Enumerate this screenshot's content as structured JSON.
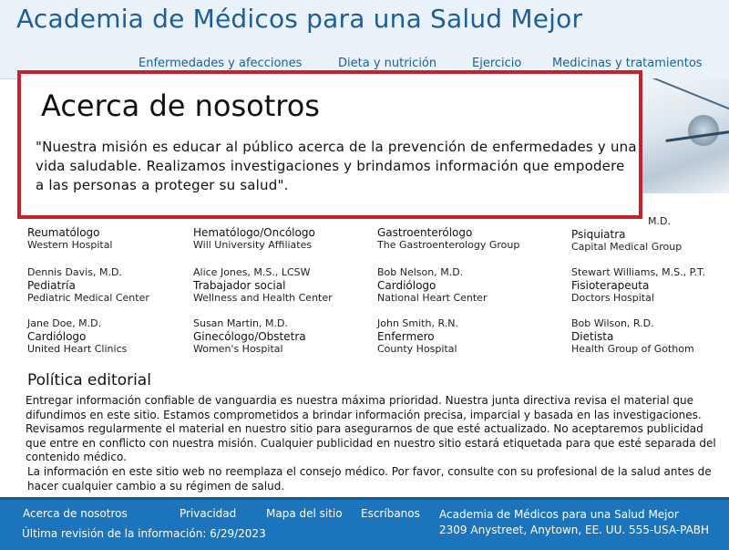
{
  "site_title": "Academia de Médicos para una Salud Mejor",
  "nav": [
    {
      "label": "Enfermedades y afecciones"
    },
    {
      "label": "Dieta y nutrición"
    },
    {
      "label": "Ejercicio"
    },
    {
      "label": "Medicinas y tratamientos"
    }
  ],
  "callout": {
    "title": "Acerca de nosotros",
    "body": "\"Nuestra misión es educar al público acerca de la prevención de enfermedades y una vida saludable. Realizamos investigaciones y brindamos información que empodere a las personas a proteger su salud\"."
  },
  "staff": [
    {
      "name": "",
      "role": "Reumatólogo",
      "org": "Western Hospital"
    },
    {
      "name": "",
      "role": "Hematólogo/Oncólogo",
      "org": "Will University Affiliates"
    },
    {
      "name": "",
      "role": "Gastroenterólogo",
      "org": "The Gastroenterology Group"
    },
    {
      "name": "M.D.",
      "role": "Psiquiatra",
      "org": "Capital Medical Group"
    },
    {
      "name": "Dennis Davis, M.D.",
      "role": "Pediatría",
      "org": "Pediatric Medical Center"
    },
    {
      "name": "Alice Jones, M.S., LCSW",
      "role": "Trabajador social",
      "org": "Wellness and Health Center"
    },
    {
      "name": "Bob Nelson, M.D.",
      "role": "Cardiólogo",
      "org": "National Heart Center"
    },
    {
      "name": "Stewart Williams, M.S., P.T.",
      "role": "Fisioterapeuta",
      "org": "Doctors Hospital"
    },
    {
      "name": "Jane Doe, M.D.",
      "role": "Cardiólogo",
      "org": "United Heart Clinics"
    },
    {
      "name": "Susan Martin, M.D.",
      "role": "Ginecólogo/Obstetra",
      "org": "Women's Hospital"
    },
    {
      "name": "John Smith, R.N.",
      "role": "Enfermero",
      "org": "County Hospital"
    },
    {
      "name": "Bob Wilson, R.D.",
      "role": "Dietista",
      "org": "Health Group of Gothom"
    }
  ],
  "policy": {
    "title": "Política editorial",
    "p1": "Entregar información confiable de vanguardia es nuestra máxima prioridad. Nuestra junta directiva revisa el material que difundimos en este sitio. Estamos comprometidos a brindar información precisa, imparcial y basada en las investigaciones. Revisamos regularmente el material en nuestro sitio para asegurarnos de que esté actualizado. No aceptaremos publicidad que entre en conflicto con nuestra misión. Cualquier publicidad en nuestro sitio estará etiquetada para que esté separada del contenido médico.",
    "p2": "La información en este sitio web no reemplaza el consejo médico. Por favor, consulte con su profesional de la salud antes de hacer cualquier cambio a su régimen de salud."
  },
  "footer": {
    "links": [
      {
        "label": "Acerca de nosotros"
      },
      {
        "label": "Privacidad"
      },
      {
        "label": "Mapa del sitio"
      },
      {
        "label": "Escríbanos"
      }
    ],
    "revised": "Última revisión de la información: 6/29/2023",
    "org_name": "Academia de Médicos para una Salud Mejor",
    "address": "2309 Anystreet, Anytown, EE. UU. 555-USA-PABH"
  },
  "colors": {
    "brand_blue": "#1e5f99",
    "footer_blue": "#1c75bc",
    "callout_border": "#c8202a"
  }
}
